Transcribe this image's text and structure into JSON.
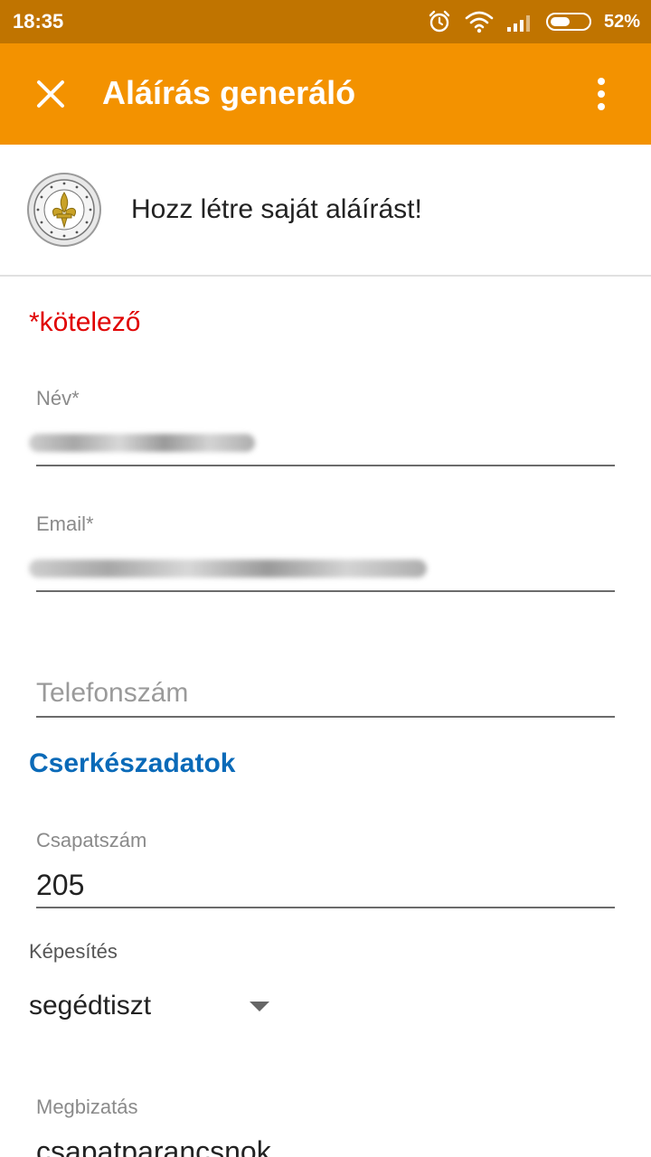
{
  "status_bar": {
    "time": "18:35",
    "battery_percent": "52%",
    "battery_level": 0.52,
    "icons": [
      "alarm-icon",
      "wifi-icon",
      "signal-icon",
      "battery-icon"
    ]
  },
  "app_bar": {
    "title": "Aláírás generáló",
    "close_icon": "close-icon",
    "menu_icon": "more-vert-icon",
    "color": "#f39200"
  },
  "header": {
    "headline": "Hozz létre saját aláírást!",
    "logo_text": "MAGYAR CSERKÉSZSZÖVETSÉG"
  },
  "form": {
    "required_note": "*kötelező",
    "name": {
      "label": "Név*",
      "value": ""
    },
    "email": {
      "label": "Email*",
      "value": ""
    },
    "phone": {
      "placeholder": "Telefonszám",
      "value": ""
    },
    "section_title": "Cserkészadatok",
    "team_number": {
      "label": "Csapatszám",
      "value": "205"
    },
    "qualification": {
      "label": "Képesítés",
      "value": "segédtiszt"
    },
    "assignment": {
      "label": "Megbizatás",
      "value": "csapatparancsnok"
    }
  },
  "colors": {
    "status_bar": "#c07400",
    "required": "#e00000",
    "section": "#0a6ab8"
  }
}
